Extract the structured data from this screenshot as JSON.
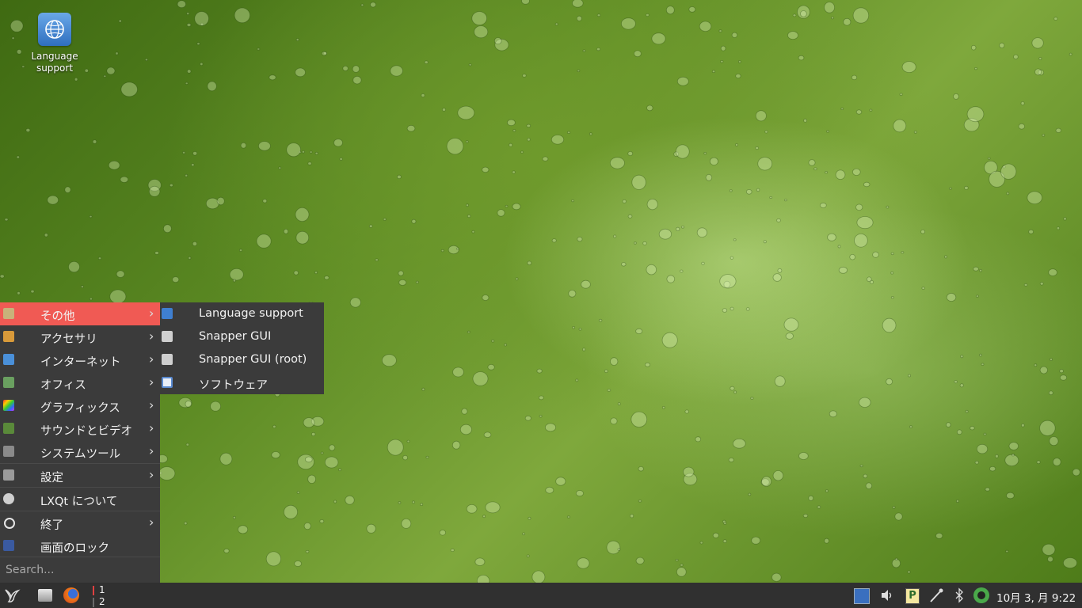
{
  "desktop": {
    "icon_label": "Language support",
    "icon_name": "language-support-icon"
  },
  "menu": {
    "items": [
      {
        "label": "その他",
        "icon": "other-icon",
        "has_submenu": true,
        "active": true
      },
      {
        "label": "アクセサリ",
        "icon": "accessories-icon",
        "has_submenu": true
      },
      {
        "label": "インターネット",
        "icon": "internet-icon",
        "has_submenu": true
      },
      {
        "label": "オフィス",
        "icon": "office-icon",
        "has_submenu": true
      },
      {
        "label": "グラフィックス",
        "icon": "graphics-icon",
        "has_submenu": true
      },
      {
        "label": "サウンドとビデオ",
        "icon": "sound-video-icon",
        "has_submenu": true
      },
      {
        "label": "システムツール",
        "icon": "system-tools-icon",
        "has_submenu": true
      },
      {
        "label": "設定",
        "icon": "settings-icon",
        "has_submenu": true
      },
      {
        "label": "LXQt について",
        "icon": "about-icon",
        "has_submenu": false
      },
      {
        "label": "終了",
        "icon": "power-icon",
        "has_submenu": true
      },
      {
        "label": "画面のロック",
        "icon": "lock-screen-icon",
        "has_submenu": false
      }
    ],
    "search_placeholder": "Search...",
    "arrow": "›",
    "active_color": "#f05a54"
  },
  "submenu": {
    "items": [
      {
        "label": "Language support",
        "icon": "language-support-icon"
      },
      {
        "label": "Snapper GUI",
        "icon": "snapper-icon"
      },
      {
        "label": "Snapper GUI (root)",
        "icon": "snapper-root-icon"
      },
      {
        "label": "ソフトウェア",
        "icon": "software-icon"
      }
    ]
  },
  "taskbar": {
    "workspaces": [
      "1",
      "2"
    ],
    "clock": "10月 3, 月 9:22"
  }
}
